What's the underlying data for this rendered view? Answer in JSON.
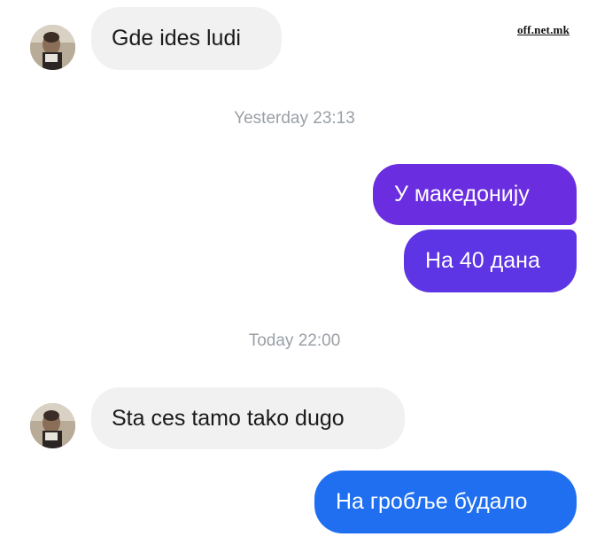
{
  "watermark": "off.net.mk",
  "colors": {
    "incoming_bubble": "#f1f1f1",
    "outgoing_purple": "#6a2ee0",
    "outgoing_blue": "#1f6ff0",
    "timestamp_text": "#9aa0a6"
  },
  "messages": [
    {
      "direction": "incoming",
      "text": "Gde ides ludi"
    },
    {
      "type": "timestamp",
      "text": "Yesterday 23:13"
    },
    {
      "direction": "outgoing",
      "text": "У македонију"
    },
    {
      "direction": "outgoing",
      "text": "На 40 дана"
    },
    {
      "type": "timestamp",
      "text": "Today 22:00"
    },
    {
      "direction": "incoming",
      "text": "Sta ces tamo tako dugo"
    },
    {
      "direction": "outgoing",
      "text": "На гробље будало"
    }
  ]
}
